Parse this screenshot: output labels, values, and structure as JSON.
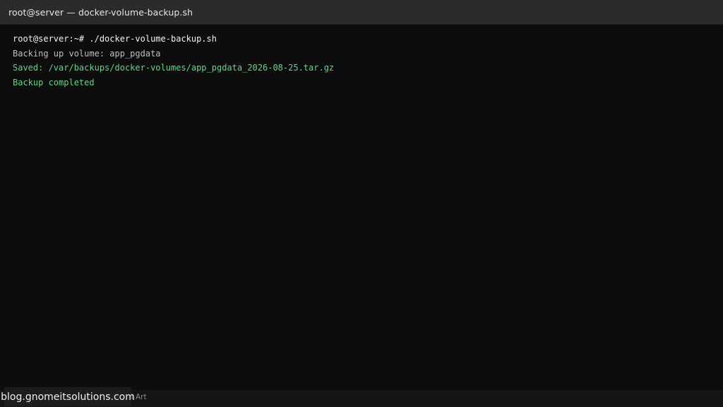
{
  "window": {
    "title": "root@server — docker-volume-backup.sh"
  },
  "terminal": {
    "lines": [
      {
        "text": "root@server:~# ./docker-volume-backup.sh",
        "kind": "command"
      },
      {
        "text": "Backing up volume: app_pgdata",
        "kind": "info"
      },
      {
        "text": "Saved: /var/backups/docker-volumes/app_pgdata_2026-08-25.tar.gz",
        "kind": "success"
      },
      {
        "text": "Backup completed",
        "kind": "success"
      }
    ]
  },
  "footer": {
    "credit": "Tutorial Art",
    "watermark": "blog.gnomeitsolutions.com"
  },
  "colors": {
    "background": "#0d0d0d",
    "titlebar": "#2b2b2b",
    "command_text": "#f2f2f2",
    "info_text": "#bdbdbd",
    "success_text": "#67d38a"
  }
}
